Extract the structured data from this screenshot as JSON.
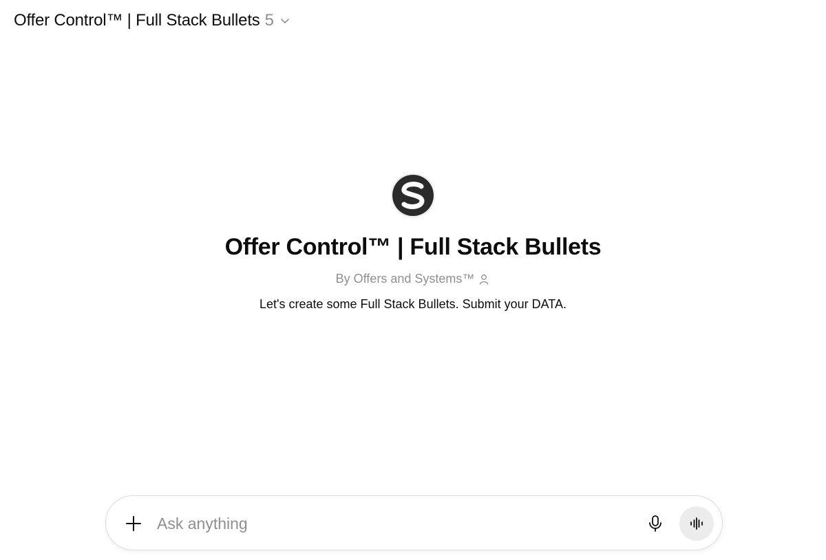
{
  "header": {
    "title": "Offer Control™ | Full Stack Bullets",
    "version": "5",
    "chevron_icon": "chevron-down-icon"
  },
  "gpt": {
    "logo_icon": "s-logo-icon",
    "name": "Offer Control™ | Full Stack Bullets",
    "byline": "By Offers and Systems™",
    "byline_icon": "person-icon",
    "description": "Let's create some Full Stack Bullets. Submit your DATA."
  },
  "composer": {
    "placeholder": "Ask anything",
    "value": "",
    "plus_icon": "plus-icon",
    "mic_icon": "microphone-icon",
    "voice_icon": "voice-waveform-icon"
  },
  "colors": {
    "text": "#0d0d0d",
    "muted": "#8f8f8f",
    "voice_button_bg": "#ececec",
    "composer_border": "#dcdcdc",
    "logo": "#2b2b2b"
  }
}
